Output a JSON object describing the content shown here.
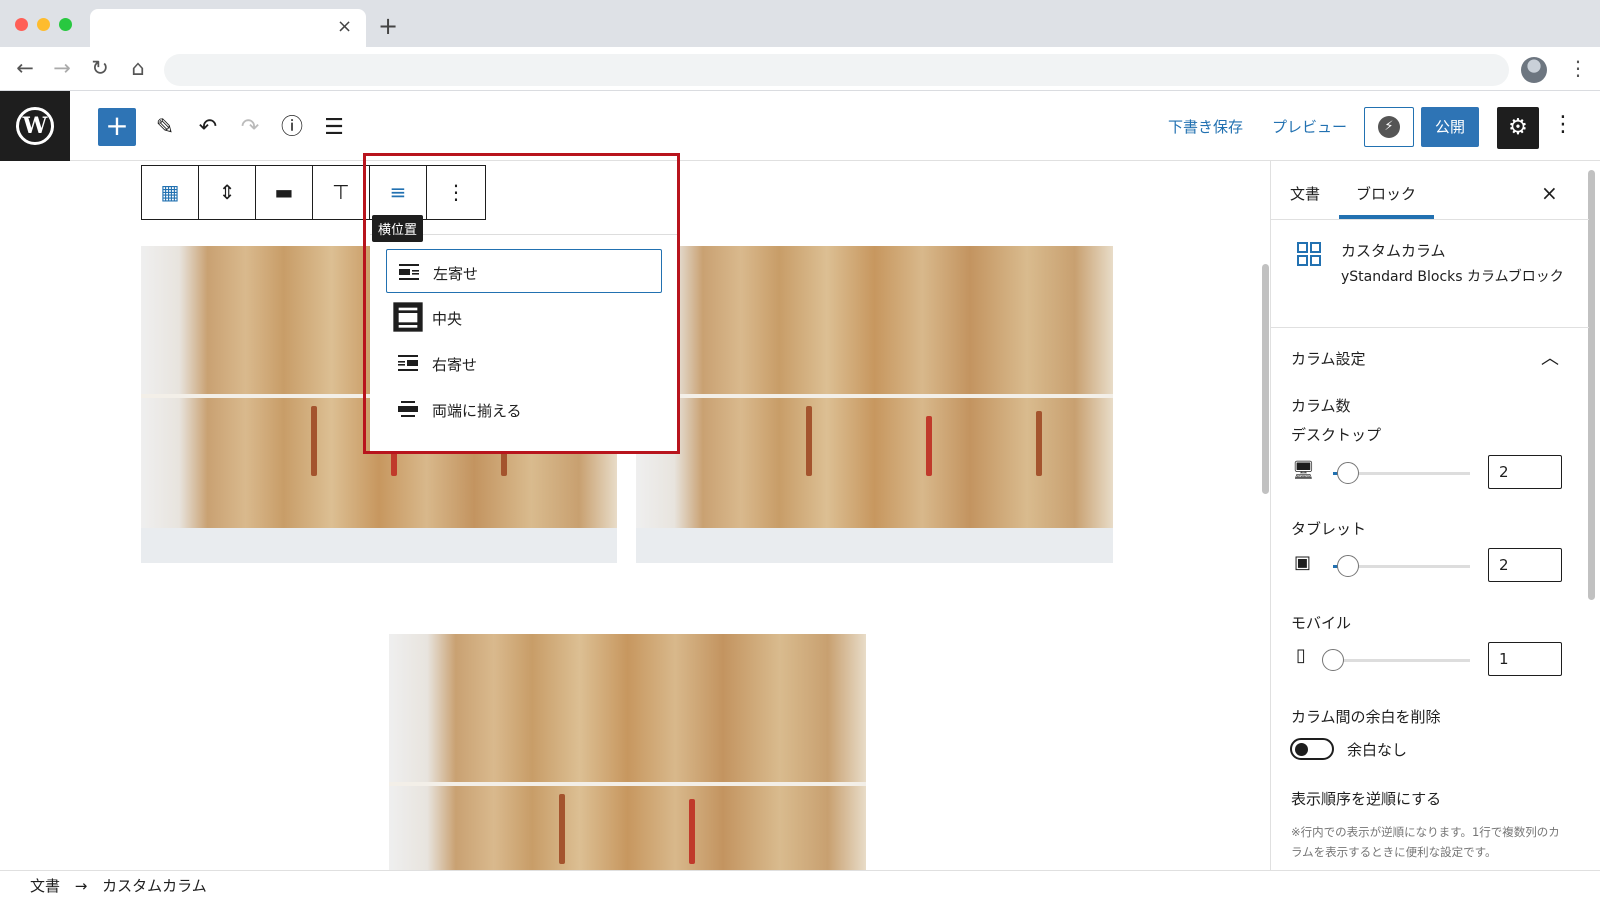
{
  "browser": {
    "new_tab": "+",
    "tab_close": "×"
  },
  "header": {
    "add_label": "+",
    "save_draft": "下書き保存",
    "preview": "プレビュー",
    "publish": "公開",
    "more": "⋮"
  },
  "block_toolbar": {
    "tooltip": "横位置",
    "more": "⋮"
  },
  "alignment_menu": {
    "items": [
      {
        "label": "左寄せ",
        "icon": "align-left-icon",
        "selected": true
      },
      {
        "label": "中央",
        "icon": "align-center-icon",
        "selected": false
      },
      {
        "label": "右寄せ",
        "icon": "align-right-icon",
        "selected": false
      },
      {
        "label": "両端に揃える",
        "icon": "align-wide-icon",
        "selected": false
      }
    ]
  },
  "sidebar": {
    "tabs": [
      {
        "label": "文書",
        "active": false
      },
      {
        "label": "ブロック",
        "active": true
      }
    ],
    "close": "×",
    "block": {
      "name": "カスタムカラム",
      "description": "yStandard Blocks カラムブロック"
    },
    "panel": {
      "title": "カラム設定",
      "column_count_label": "カラム数",
      "devices": [
        {
          "label": "デスクトップ",
          "icon": "desktop-icon",
          "value": "2",
          "fraction": 0.11
        },
        {
          "label": "タブレット",
          "icon": "tablet-icon",
          "value": "2",
          "fraction": 0.11
        },
        {
          "label": "モバイル",
          "icon": "mobile-icon",
          "value": "1",
          "fraction": 0
        }
      ],
      "gap_label": "カラム間の余白を削除",
      "gap_toggle_label": "余白なし",
      "gap_toggle_on": false,
      "reverse_label": "表示順序を逆順にする",
      "help": "※行内での表示が逆順になります。1行で複数列のカラムを表示するときに便利な設定です。"
    }
  },
  "breadcrumb": {
    "items": [
      "文書",
      "カスタムカラム"
    ],
    "separator": "→"
  },
  "colors": {
    "accent": "#2271b1",
    "highlight_box": "#b8141d",
    "wp_dark": "#1e1e1e"
  }
}
